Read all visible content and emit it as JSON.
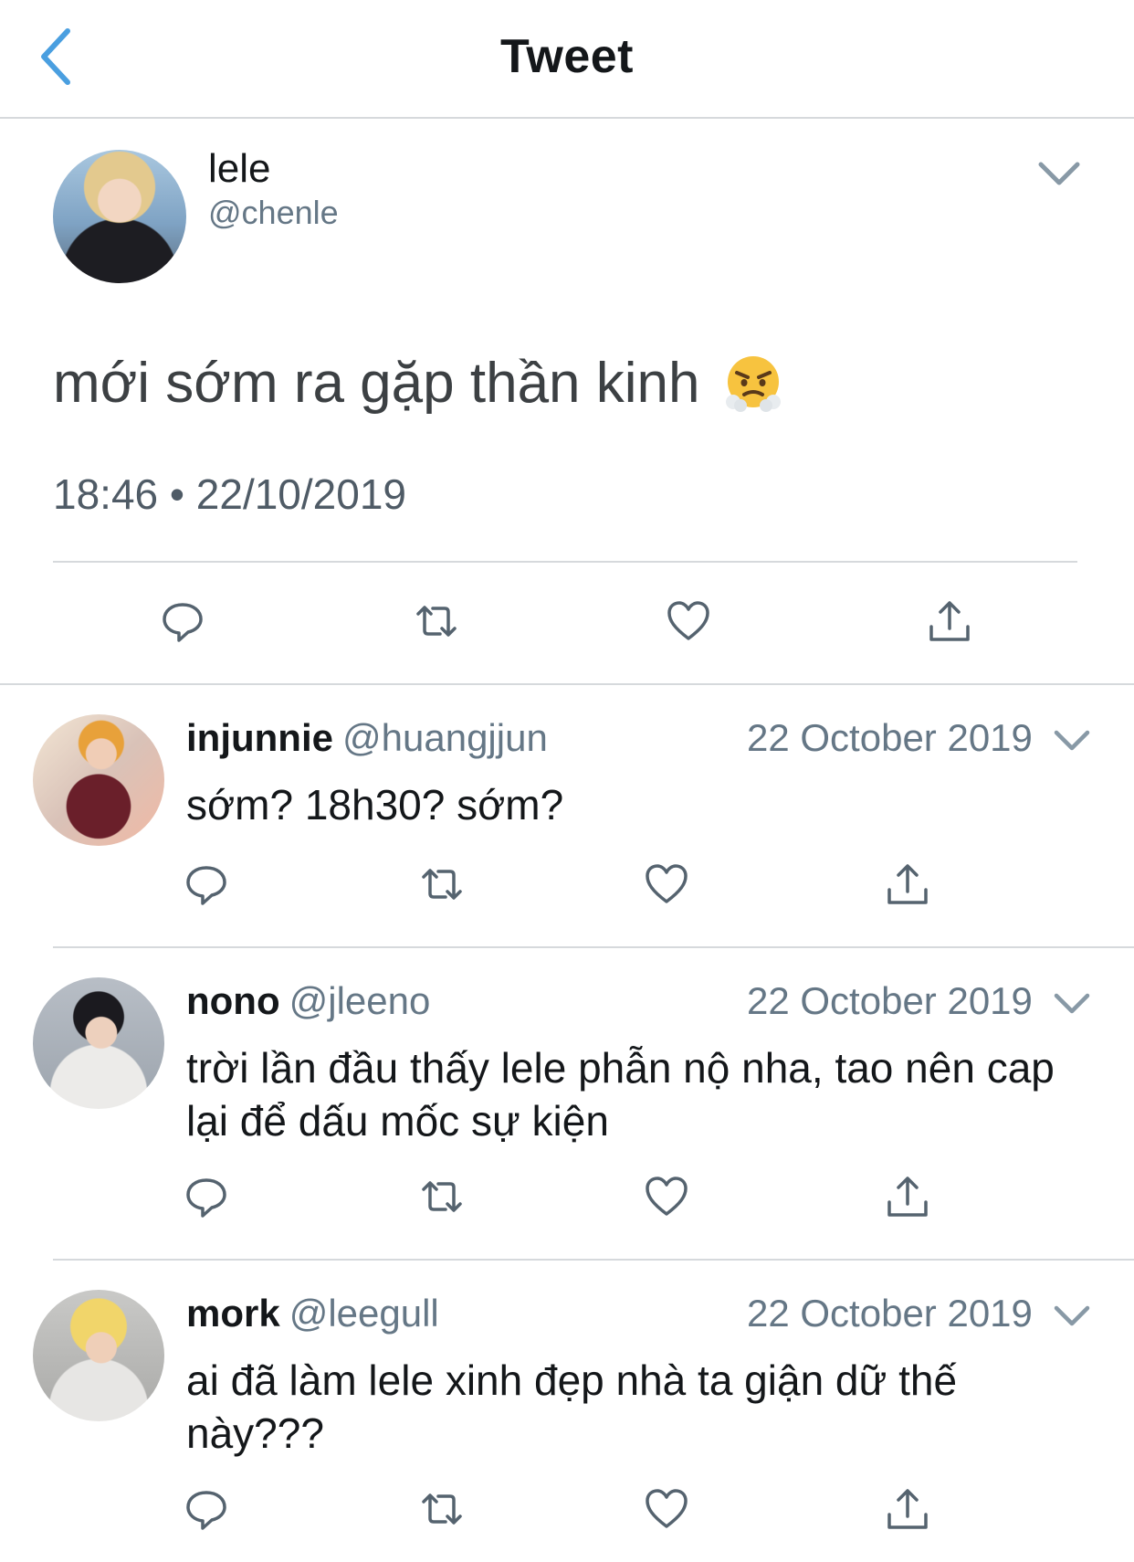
{
  "header": {
    "title": "Tweet",
    "back_icon": "chevron-left-icon"
  },
  "colors": {
    "accent": "#4a9fe0",
    "text": "#14171a",
    "secondary": "#657786",
    "divider": "#d6d9dc",
    "icon": "#55636f"
  },
  "main_tweet": {
    "name": "lele",
    "handle": "@chenle",
    "text": "mới sớm ra gặp thần kinh",
    "emoji": "face-with-steam-from-nose",
    "timestamp": "18:46 • 22/10/2019"
  },
  "replies": [
    {
      "name": "injunnie",
      "handle": "@huangjjun",
      "date": "22 October 2019",
      "text": "sớm? 18h30? sớm?"
    },
    {
      "name": "nono",
      "handle": "@jleeno",
      "date": "22 October 2019",
      "text": "trời lần đầu thấy lele phẫn nộ nha, tao nên cap lại để dấu mốc sự kiện"
    },
    {
      "name": "mork",
      "handle": "@leegull",
      "date": "22 October 2019",
      "text": "ai đã làm lele xinh đẹp nhà ta giận dữ thế này???"
    }
  ]
}
